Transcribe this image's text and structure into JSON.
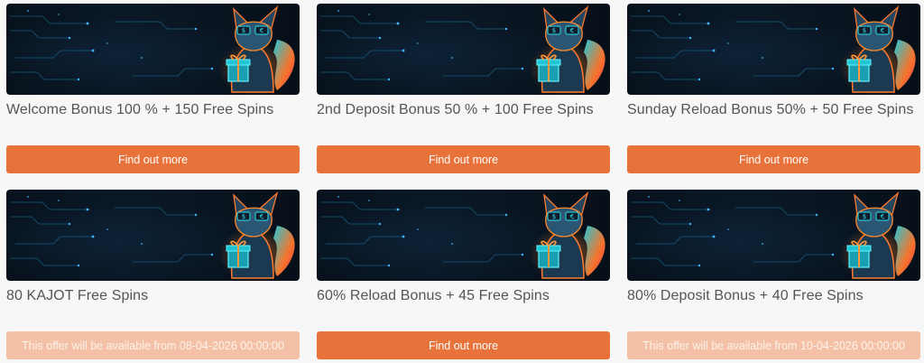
{
  "colors": {
    "accent": "#e8733a",
    "accent_disabled": "#f4c1a6",
    "title_text": "#555555",
    "banner_bg": "#0a1826"
  },
  "banner_icon": "kajot-fox-mascot-with-gift",
  "offers": [
    {
      "title": "Welcome Bonus 100 % + 150 Free Spins",
      "action": "Find out more",
      "available": true
    },
    {
      "title": "2nd Deposit Bonus 50 % + 100 Free Spins",
      "action": "Find out more",
      "available": true
    },
    {
      "title": "Sunday Reload Bonus 50% + 50 Free Spins",
      "action": "Find out more",
      "available": true
    },
    {
      "title": "80 KAJOT Free Spins",
      "action": "This offer will be available from 08-04-2026 00:00:00",
      "available": false
    },
    {
      "title": "60% Reload Bonus + 45 Free Spins",
      "action": "Find out more",
      "available": true
    },
    {
      "title": "80% Deposit Bonus + 40 Free Spins",
      "action": "This offer will be available from 10-04-2026 00:00:00",
      "available": false
    }
  ]
}
